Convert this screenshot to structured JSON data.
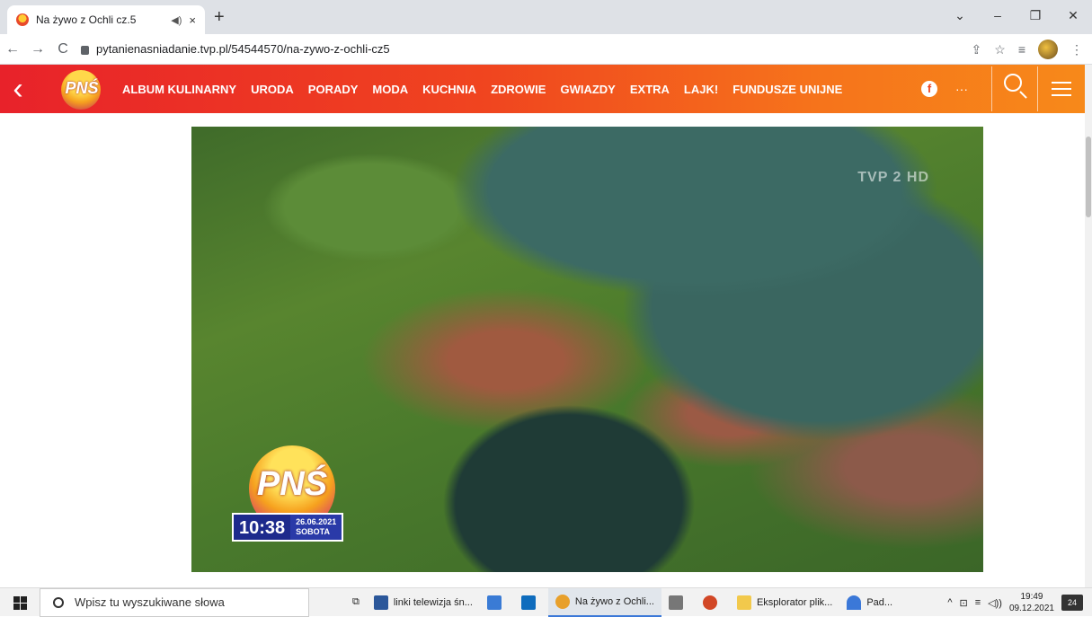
{
  "browser": {
    "tab_title": "Na żywo z Ochli cz.5",
    "audio_icon": "◀︎)",
    "close_glyph": "×",
    "new_tab": "+",
    "url": "pytanienasniadanie.tvp.pl/54544570/na-zywo-z-ochli-cz5",
    "window_controls": [
      "⌄",
      "–",
      "❐",
      "✕"
    ]
  },
  "site": {
    "logo_text": "PNŚ",
    "menu": [
      "ALBUM KULINARNY",
      "URODA",
      "PORADY",
      "MODA",
      "KUCHNIA",
      "ZDROWIE",
      "GWIAZDY",
      "EXTRA",
      "LAJK!",
      "FUNDUSZE UNIJNE"
    ],
    "facebook_label": "f",
    "more_label": "···",
    "accent_start": "#e8222a",
    "accent_end": "#f7891a"
  },
  "video": {
    "channel_logo": "TVP 2 HD",
    "badge_text": "PNŚ",
    "time": "10:38",
    "date": "26.06.2021",
    "weekday": "SOBOTA"
  },
  "taskbar": {
    "search_placeholder": "Wpisz tu wyszukiwane słowa",
    "items": [
      {
        "label": "linki telewizja śn...",
        "icon": "word-icon",
        "color": "#2b579a"
      },
      {
        "label": "Na żywo z Ochli...",
        "icon": "chrome-icon",
        "color": "#e8a02b"
      },
      {
        "label": "Eksplorator plik...",
        "icon": "folder-icon",
        "color": "#f2c94c"
      },
      {
        "label": "Pad...",
        "icon": "umbrella-icon",
        "color": "#3b78d8"
      }
    ],
    "time": "19:49",
    "date": "09.12.2021",
    "notification_count": "24"
  }
}
